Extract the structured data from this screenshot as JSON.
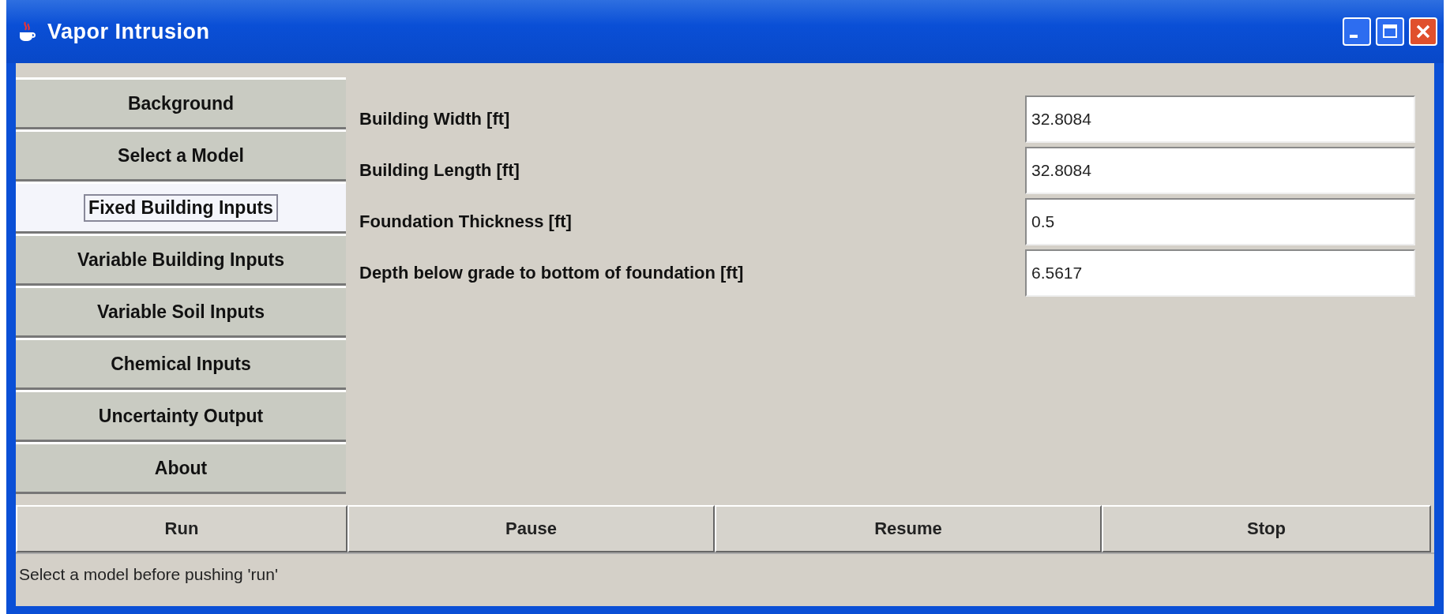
{
  "window": {
    "title": "Vapor Intrusion"
  },
  "sidebar": {
    "items": [
      {
        "label": "Background",
        "selected": false
      },
      {
        "label": "Select a Model",
        "selected": false
      },
      {
        "label": "Fixed Building Inputs",
        "selected": true
      },
      {
        "label": "Variable Building Inputs",
        "selected": false
      },
      {
        "label": "Variable Soil Inputs",
        "selected": false
      },
      {
        "label": "Chemical Inputs",
        "selected": false
      },
      {
        "label": "Uncertainty Output",
        "selected": false
      },
      {
        "label": "About",
        "selected": false
      }
    ]
  },
  "fields": [
    {
      "label": "Building Width [ft]",
      "value": "32.8084"
    },
    {
      "label": "Building Length [ft]",
      "value": "32.8084"
    },
    {
      "label": "Foundation Thickness [ft]",
      "value": "0.5"
    },
    {
      "label": "Depth below grade to bottom of foundation [ft]",
      "value": "6.5617"
    }
  ],
  "buttons": [
    "Run",
    "Pause",
    "Resume",
    "Stop"
  ],
  "status_bar": "Select a model before pushing 'run'"
}
